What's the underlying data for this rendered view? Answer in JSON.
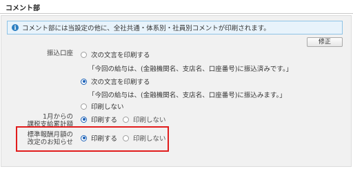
{
  "section": {
    "title": "コメント部"
  },
  "info": {
    "icon": "info-icon",
    "text": "コメント部には当設定の他に、全社共通・体系別・社員別コメントが印刷されます。"
  },
  "edit_button": {
    "label": "修正"
  },
  "transfer": {
    "label": "振込口座",
    "option1": {
      "label": "次の文言を印刷する",
      "selected": false
    },
    "quote1": "「今回の給与は、(金融機関名、支店名、口座番号)に振込済みです。」",
    "option2": {
      "label": "次の文言を印刷する",
      "selected": true
    },
    "quote2": "「今回の給与は、(金融機関名、支店名、口座番号)に振込みます。」",
    "option3": {
      "label": "印刷しない",
      "selected": false
    }
  },
  "cumulative": {
    "label_line1": "1月からの",
    "label_line2": "課税支給累計額",
    "print": {
      "label": "印刷する",
      "selected": true
    },
    "noprint": {
      "label": "印刷しない",
      "selected": false
    }
  },
  "standard": {
    "label_line1": "標準報酬月額の",
    "label_line2": "改定のお知らせ",
    "print": {
      "label": "印刷する",
      "selected": true
    },
    "noprint": {
      "label": "印刷しない",
      "selected": false
    }
  },
  "colors": {
    "highlight": "#e11b1b",
    "radio_selected": "#1f63b8",
    "info_border": "#8ec3e6"
  }
}
